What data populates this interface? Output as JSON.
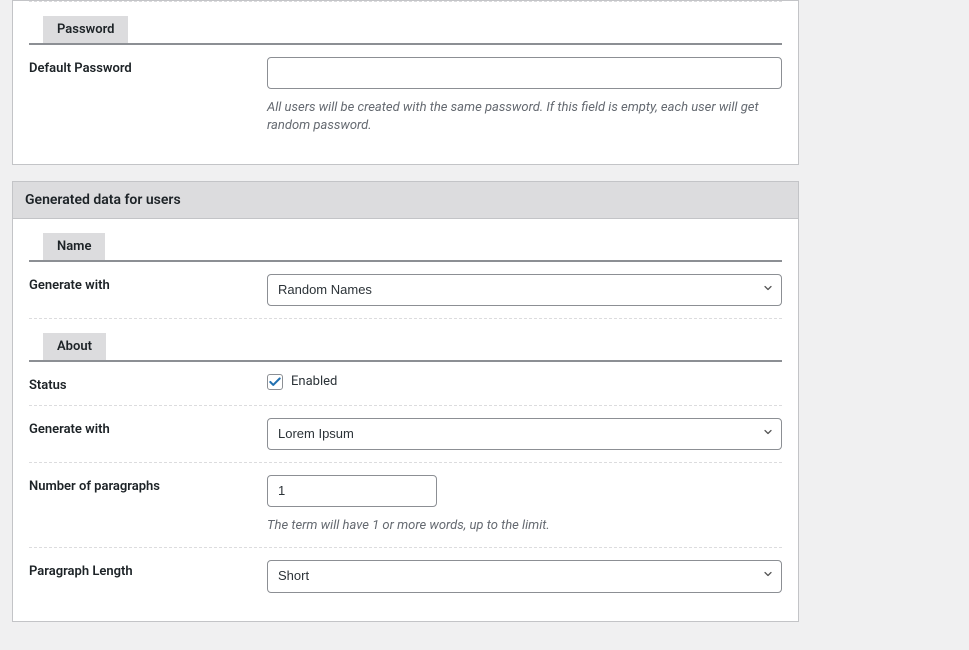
{
  "password_section": {
    "tab_label": "Password",
    "default_password_label": "Default Password",
    "default_password_value": "",
    "default_password_help": "All users will be created with the same password. If this field is empty, each user will get random password."
  },
  "generated_section": {
    "header": "Generated data for users",
    "name_tab": "Name",
    "name_generate_with_label": "Generate with",
    "name_generate_with_value": "Random Names",
    "about_tab": "About",
    "status_label": "Status",
    "status_checkbox_label": "Enabled",
    "about_generate_with_label": "Generate with",
    "about_generate_with_value": "Lorem Ipsum",
    "paragraphs_label": "Number of paragraphs",
    "paragraphs_value": "1",
    "paragraphs_help": "The term will have 1 or more words, up to the limit.",
    "paragraph_length_label": "Paragraph Length",
    "paragraph_length_value": "Short"
  }
}
